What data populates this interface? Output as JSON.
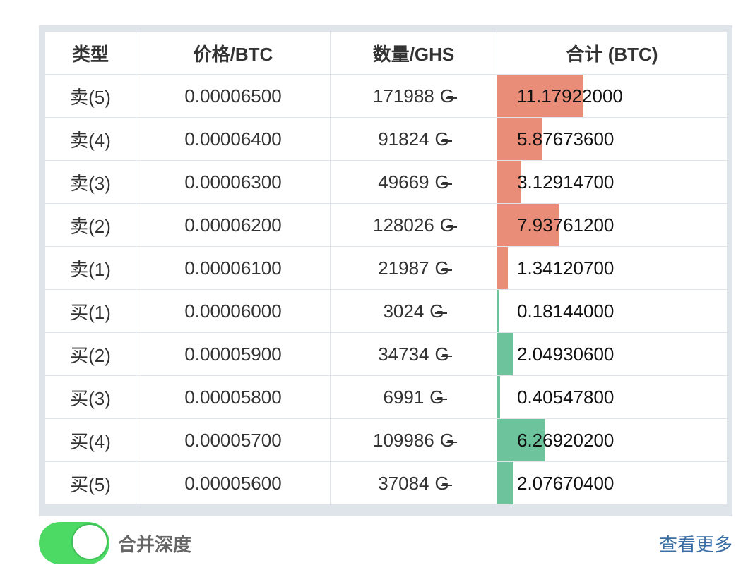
{
  "headers": {
    "type": "类型",
    "price": "价格/BTC",
    "amount": "数量/GHS",
    "total": "合计 (BTC)"
  },
  "unit_symbol": "G",
  "bar_max_total": 11.17922,
  "colors": {
    "sell_text": "#d9534f",
    "buy_text": "#5cb990",
    "sell_bar": "#e98c78",
    "buy_bar": "#6cc39c",
    "toggle_on": "#4cd964",
    "link": "#3a6ea5"
  },
  "rows": [
    {
      "side": "sell",
      "type": "卖(5)",
      "price": "0.00006500",
      "amount": "171988",
      "total": "11.17922000",
      "bar": 11.17922
    },
    {
      "side": "sell",
      "type": "卖(4)",
      "price": "0.00006400",
      "amount": "91824",
      "total": "5.87673600",
      "bar": 5.876736
    },
    {
      "side": "sell",
      "type": "卖(3)",
      "price": "0.00006300",
      "amount": "49669",
      "total": "3.12914700",
      "bar": 3.129147
    },
    {
      "side": "sell",
      "type": "卖(2)",
      "price": "0.00006200",
      "amount": "128026",
      "total": "7.93761200",
      "bar": 7.937612
    },
    {
      "side": "sell",
      "type": "卖(1)",
      "price": "0.00006100",
      "amount": "21987",
      "total": "1.34120700",
      "bar": 1.341207
    },
    {
      "side": "buy",
      "type": "买(1)",
      "price": "0.00006000",
      "amount": "3024",
      "total": "0.18144000",
      "bar": 0.18144
    },
    {
      "side": "buy",
      "type": "买(2)",
      "price": "0.00005900",
      "amount": "34734",
      "total": "2.04930600",
      "bar": 2.049306
    },
    {
      "side": "buy",
      "type": "买(3)",
      "price": "0.00005800",
      "amount": "6991",
      "total": "0.40547800",
      "bar": 0.405478
    },
    {
      "side": "buy",
      "type": "买(4)",
      "price": "0.00005700",
      "amount": "109986",
      "total": "6.26920200",
      "bar": 6.269202
    },
    {
      "side": "buy",
      "type": "买(5)",
      "price": "0.00005600",
      "amount": "37084",
      "total": "2.07670400",
      "bar": 2.076704
    }
  ],
  "footer": {
    "merge_depth_label": "合并深度",
    "merge_depth_on": true,
    "more_link": "查看更多"
  }
}
